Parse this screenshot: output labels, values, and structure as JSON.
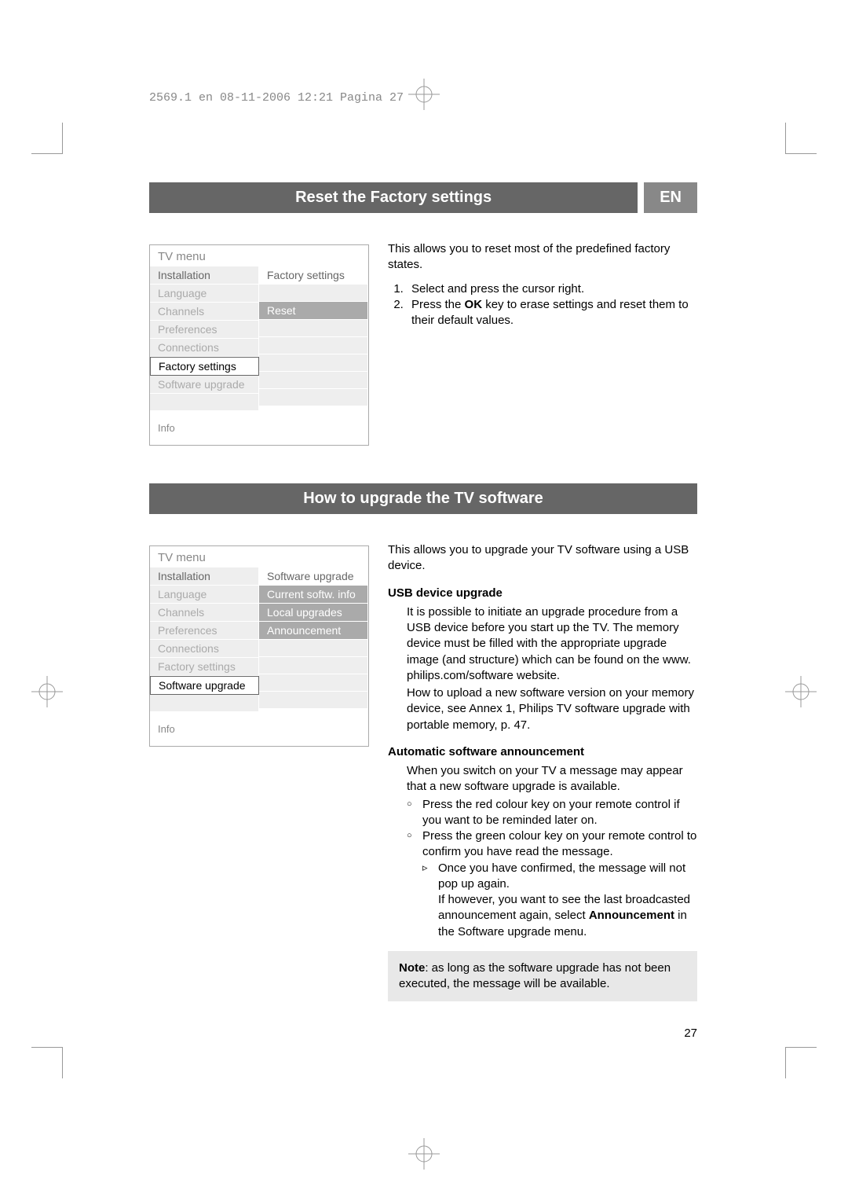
{
  "print_header": "2569.1 en  08-11-2006  12:21  Pagina 27",
  "page_number": "27",
  "lang_badge": "EN",
  "sections": {
    "reset": {
      "title": "Reset the Factory settings",
      "menu": {
        "title": "TV menu",
        "left": {
          "header": "Installation",
          "items": [
            "Language",
            "Channels",
            "Preferences",
            "Connections",
            "Factory settings",
            "Software upgrade"
          ],
          "selected_index": 4
        },
        "right": {
          "header": "Factory settings",
          "items": [
            "Reset"
          ],
          "highlighted_index": 1
        },
        "info": "Info"
      },
      "intro": "This allows you to reset most of the predefined factory states.",
      "steps": [
        "Select and press the cursor right.",
        "Press the OK key to erase settings and reset them to their default values."
      ]
    },
    "upgrade": {
      "title": "How to upgrade the TV software",
      "menu": {
        "title": "TV menu",
        "left": {
          "header": "Installation",
          "items": [
            "Language",
            "Channels",
            "Preferences",
            "Connections",
            "Factory settings",
            "Software upgrade"
          ],
          "selected_index": 5
        },
        "right": {
          "header": "Software upgrade",
          "items": [
            "Current softw. info",
            "Local upgrades",
            "Announcement"
          ]
        },
        "info": "Info"
      },
      "intro": "This allows you to upgrade your TV software using a USB device.",
      "usb_head": "USB device upgrade",
      "usb_p1": "It is possible to initiate an upgrade procedure from a USB device before you start up the TV. The memory device must be filled with the appropriate upgrade image (and structure) which can be found on the www. philips.com/software website.",
      "usb_p2": "How to upload a new software version on your memory device, see Annex 1, Philips TV software upgrade with portable memory, p. 47.",
      "auto_head": "Automatic software announcement",
      "auto_intro": "When you switch on your TV a message may appear that a new software upgrade is available.",
      "auto_bullets": [
        "Press the red colour key on your remote control if you want to be reminded later on.",
        "Press the green colour key on your remote control to confirm you have read the message."
      ],
      "auto_tri": "Once you have confirmed, the message will not pop up again.",
      "auto_tri_followup": "If however, you want to see the last broadcasted announcement again, select Announcement in the Software upgrade menu.",
      "note": "Note: as long as the software upgrade has not been executed, the message will be available."
    }
  }
}
